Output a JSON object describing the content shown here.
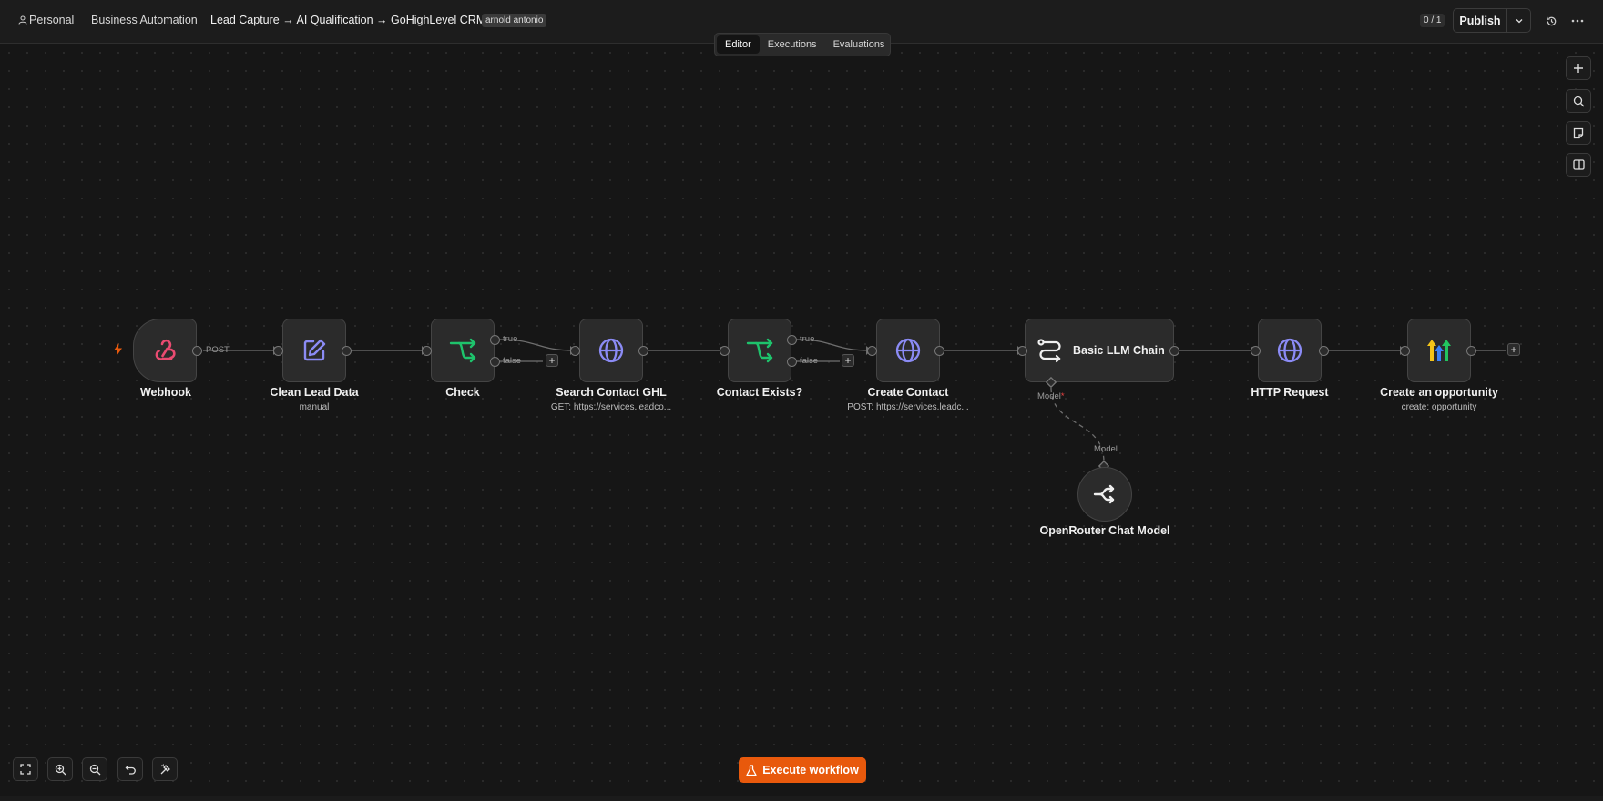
{
  "header": {
    "project": "Personal",
    "folder": "Business Automation",
    "workflow_name": "Lead Capture → AI Qualification → GoHighLevel CRM",
    "tag": "arnold antonio",
    "counter": "0 / 1",
    "publish_label": "Publish",
    "icons": [
      "user-icon",
      "chevron-down-icon",
      "history-icon",
      "more-icon"
    ]
  },
  "tabs": [
    {
      "label": "Editor",
      "active": true
    },
    {
      "label": "Executions",
      "active": false
    },
    {
      "label": "Evaluations",
      "active": false
    }
  ],
  "nodes": [
    {
      "name": "Webhook",
      "subtitle": "",
      "icon": "webhook-icon",
      "output_label": "POST"
    },
    {
      "name": "Clean Lead Data",
      "subtitle": "manual",
      "icon": "edit-icon"
    },
    {
      "name": "Check",
      "subtitle": "",
      "icon": "branch-icon",
      "outputs": [
        "true",
        "false"
      ]
    },
    {
      "name": "Search Contact GHL",
      "subtitle": "GET: https://services.leadco...",
      "icon": "globe-icon"
    },
    {
      "name": "Contact Exists?",
      "subtitle": "",
      "icon": "branch-icon",
      "outputs": [
        "true",
        "false"
      ]
    },
    {
      "name": "Create Contact",
      "subtitle": "POST: https://services.leadc...",
      "icon": "globe-icon"
    },
    {
      "name": "Basic LLM Chain",
      "subtitle": "",
      "icon": "chain-icon",
      "input_label": "Model"
    },
    {
      "name": "HTTP Request",
      "subtitle": "",
      "icon": "globe-icon"
    },
    {
      "name": "Create an opportunity",
      "subtitle": "create: opportunity",
      "icon": "ghl-logo-icon"
    },
    {
      "name": "OpenRouter Chat Model",
      "subtitle": "",
      "icon": "openrouter-icon",
      "output_label": "Model"
    }
  ],
  "toolbar_right": [
    "plus-icon",
    "search-icon",
    "sticky-note-icon",
    "panel-icon"
  ],
  "toolbar_bottom": [
    "fit-view-icon",
    "zoom-in-icon",
    "zoom-out-icon",
    "undo-icon",
    "tidy-up-icon"
  ],
  "execute_label": "Execute workflow",
  "colors": {
    "accent": "#e8590c",
    "branch_green": "#1ec36c",
    "globe_purple": "#8b8bf5",
    "webhook_pink": "#ea4b71"
  }
}
